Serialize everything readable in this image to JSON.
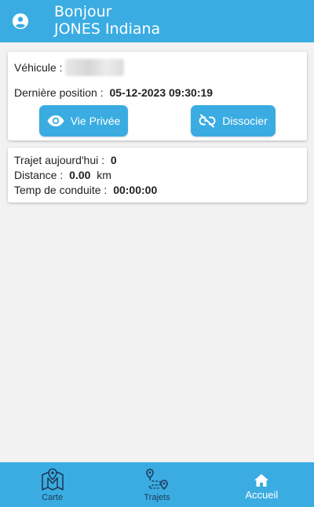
{
  "header": {
    "greeting": "Bonjour",
    "user_name": "JONES Indiana"
  },
  "vehicle_card": {
    "vehicle_label": "Véhicule :",
    "last_position_label": "Dernière position :",
    "last_position_value": "05-12-2023 09:30:19",
    "private_button_label": "Vie Privée",
    "dissociate_button_label": "Dissocier"
  },
  "stats_card": {
    "trips_label": "Trajet aujourd'hui :",
    "trips_value": "0",
    "distance_label": "Distance :",
    "distance_value": "0.00",
    "distance_unit": "km",
    "drive_time_label": "Temp de conduite :",
    "drive_time_value": "00:00:00"
  },
  "bottom_nav": {
    "items": [
      {
        "label": "Carte",
        "icon": "map-icon",
        "active": false
      },
      {
        "label": "Trajets",
        "icon": "route-icon",
        "active": false
      },
      {
        "label": "Accueil",
        "icon": "home-icon",
        "active": true
      }
    ]
  },
  "colors": {
    "primary": "#3aace2",
    "background": "#f2f2f2",
    "nav_inactive": "#1f3b57"
  }
}
